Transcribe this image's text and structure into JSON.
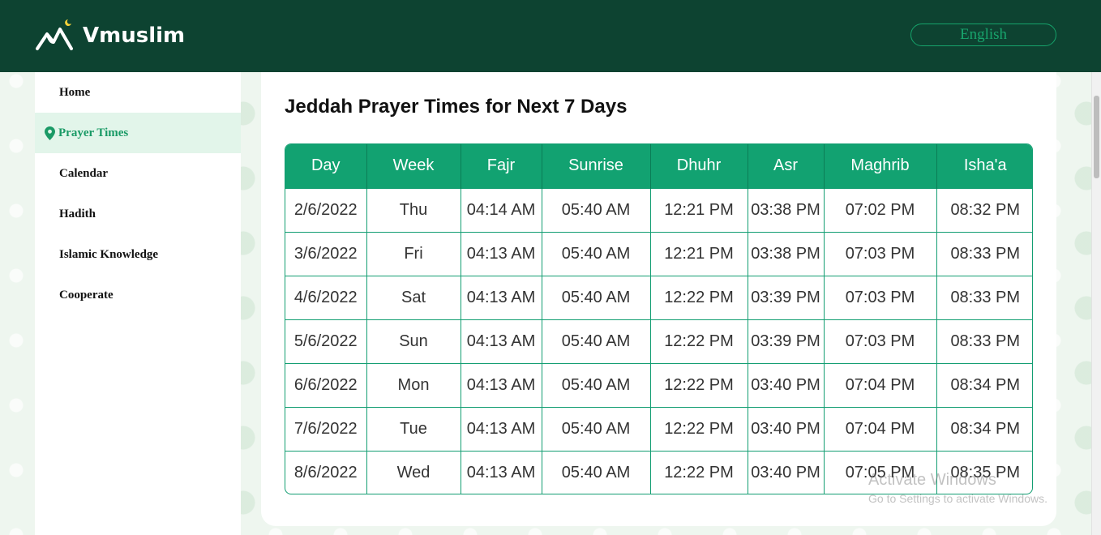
{
  "header": {
    "brand": "Vmuslim",
    "language_button": "English"
  },
  "sidebar": {
    "items": [
      {
        "label": "Home"
      },
      {
        "label": "Prayer Times",
        "active": true
      },
      {
        "label": "Calendar"
      },
      {
        "label": "Hadith"
      },
      {
        "label": "Islamic Knowledge"
      },
      {
        "label": "Cooperate"
      }
    ]
  },
  "main": {
    "title": "Jeddah Prayer Times for Next 7 Days",
    "table": {
      "headers": [
        "Day",
        "Week",
        "Fajr",
        "Sunrise",
        "Dhuhr",
        "Asr",
        "Maghrib",
        "Isha'a"
      ],
      "rows": [
        [
          "2/6/2022",
          "Thu",
          "04:14 AM",
          "05:40 AM",
          "12:21 PM",
          "03:38 PM",
          "07:02 PM",
          "08:32 PM"
        ],
        [
          "3/6/2022",
          "Fri",
          "04:13 AM",
          "05:40 AM",
          "12:21 PM",
          "03:38 PM",
          "07:03 PM",
          "08:33 PM"
        ],
        [
          "4/6/2022",
          "Sat",
          "04:13 AM",
          "05:40 AM",
          "12:22 PM",
          "03:39 PM",
          "07:03 PM",
          "08:33 PM"
        ],
        [
          "5/6/2022",
          "Sun",
          "04:13 AM",
          "05:40 AM",
          "12:22 PM",
          "03:39 PM",
          "07:03 PM",
          "08:33 PM"
        ],
        [
          "6/6/2022",
          "Mon",
          "04:13 AM",
          "05:40 AM",
          "12:22 PM",
          "03:40 PM",
          "07:04 PM",
          "08:34 PM"
        ],
        [
          "7/6/2022",
          "Tue",
          "04:13 AM",
          "05:40 AM",
          "12:22 PM",
          "03:40 PM",
          "07:04 PM",
          "08:34 PM"
        ],
        [
          "8/6/2022",
          "Wed",
          "04:13 AM",
          "05:40 AM",
          "12:22 PM",
          "03:40 PM",
          "07:05 PM",
          "08:35 PM"
        ]
      ]
    }
  },
  "watermark": {
    "title": "Activate Windows",
    "subtitle": "Go to Settings to activate Windows."
  },
  "colors": {
    "header_bg": "#0d4331",
    "accent": "#12a271",
    "active_nav_bg": "#e2f5ea"
  }
}
